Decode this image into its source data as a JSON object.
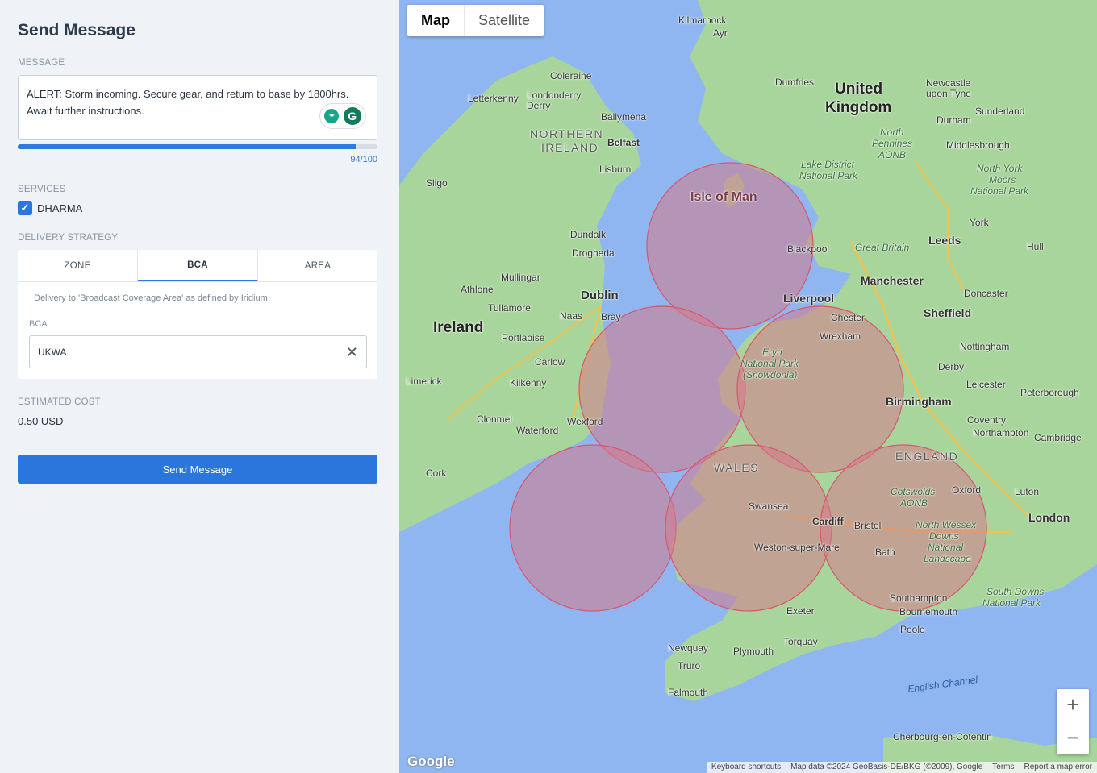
{
  "panel": {
    "title": "Send Message",
    "message": {
      "label": "MESSAGE",
      "text": "ALERT: Storm incoming. Secure gear, and return to base by 1800hrs. Await further instructions.",
      "char_count": 94,
      "char_limit": 100,
      "counter_text": "94/100",
      "grammarly_letter": "G"
    },
    "services": {
      "label": "SERVICES",
      "items": [
        {
          "name": "DHARMA",
          "checked": true
        }
      ]
    },
    "strategy": {
      "label": "DELIVERY STRATEGY",
      "tabs": [
        "ZONE",
        "BCA",
        "AREA"
      ],
      "active_tab": "BCA",
      "description": "Delivery to 'Broadcast Coverage Area' as defined by Iridium",
      "bca_label": "BCA",
      "bca_value": "UKWA"
    },
    "cost": {
      "label": "ESTIMATED COST",
      "value": "0.50 USD"
    },
    "send_label": "Send Message",
    "accent_color": "#2b76dc"
  },
  "map": {
    "type_buttons": [
      "Map",
      "Satellite"
    ],
    "active_type": "Map",
    "zoom_in": "+",
    "zoom_out": "−",
    "logo": "Google",
    "attribution": [
      "Keyboard shortcuts",
      "Map data ©2024 GeoBasis-DE/BKG (©2009), Google",
      "Terms",
      "Report a map error"
    ],
    "coverage_color": "#d47a8a",
    "labels": {
      "united_kingdom_1": "United",
      "united_kingdom_2": "Kingdom",
      "ireland": "Ireland",
      "northern_ireland_1": "NORTHERN",
      "northern_ireland_2": "IRELAND",
      "wales": "WALES",
      "england": "ENGLAND",
      "isle_of_man": "Isle of Man",
      "dublin": "Dublin",
      "belfast": "Belfast",
      "liverpool": "Liverpool",
      "manchester": "Manchester",
      "leeds": "Leeds",
      "sheffield": "Sheffield",
      "birmingham": "Birmingham",
      "london": "London",
      "cardiff": "Cardiff",
      "bristol": "Bristol",
      "swansea": "Swansea",
      "cork": "Cork",
      "limerick": "Limerick",
      "waterford": "Waterford",
      "wexford": "Wexford",
      "kilkenny": "Kilkenny",
      "carlow": "Carlow",
      "portlaoise": "Portlaoise",
      "athlone": "Athlone",
      "tullamore": "Tullamore",
      "mullingar": "Mullingar",
      "drogheda": "Drogheda",
      "dundalk": "Dundalk",
      "naas": "Naas",
      "bray": "Bray",
      "clonmel": "Clonmel",
      "sligo": "Sligo",
      "letterkenny": "Letterkenny",
      "londonderry_1": "Londonderry",
      "londonderry_2": "Derry",
      "coleraine": "Coleraine",
      "ballymena": "Ballymena",
      "lisburn": "Lisburn",
      "blackpool": "Blackpool",
      "chester": "Chester",
      "wrexham": "Wrexham",
      "preston": "Great Britain",
      "york": "York",
      "hull": "Hull",
      "doncaster": "Doncaster",
      "nottingham": "Nottingham",
      "derby": "Derby",
      "leicester": "Leicester",
      "peterborough": "Peterborough",
      "coventry": "Coventry",
      "northampton": "Northampton",
      "cambridge": "Cambridge",
      "oxford": "Oxford",
      "luton": "Luton",
      "bath": "Bath",
      "weston": "Weston-super-Mare",
      "southampton": "Southampton",
      "bournemouth": "Bournemouth",
      "poole": "Poole",
      "exeter": "Exeter",
      "torquay": "Torquay",
      "plymouth": "Plymouth",
      "newquay": "Newquay",
      "truro": "Truro",
      "falmouth": "Falmouth",
      "dumfries": "Dumfries",
      "kilmarnock": "Kilmarnock",
      "ayr": "Ayr",
      "newcastle_1": "Newcastle",
      "newcastle_2": "upon Tyne",
      "sunderland": "Sunderland",
      "durham": "Durham",
      "middlesbrough": "Middlesbrough",
      "cherbourg": "Cherbourg-en-Cotentin",
      "english_channel": "English Channel",
      "snowdonia_1": "Eryri",
      "snowdonia_2": "National Park",
      "snowdonia_3": "(Snowdonia)",
      "lake_district_1": "Lake District",
      "lake_district_2": "National Park",
      "north_pennines_1": "North",
      "north_pennines_2": "Pennines",
      "north_pennines_3": "AONB",
      "nym_1": "North York",
      "nym_2": "Moors",
      "nym_3": "National Park",
      "cotswolds_1": "Cotswolds",
      "cotswolds_2": "AONB",
      "nwd_1": "North Wessex",
      "nwd_2": "Downs",
      "nwd_3": "National",
      "nwd_4": "Landscape",
      "south_downs_1": "South Downs",
      "south_downs_2": "National Park"
    }
  }
}
